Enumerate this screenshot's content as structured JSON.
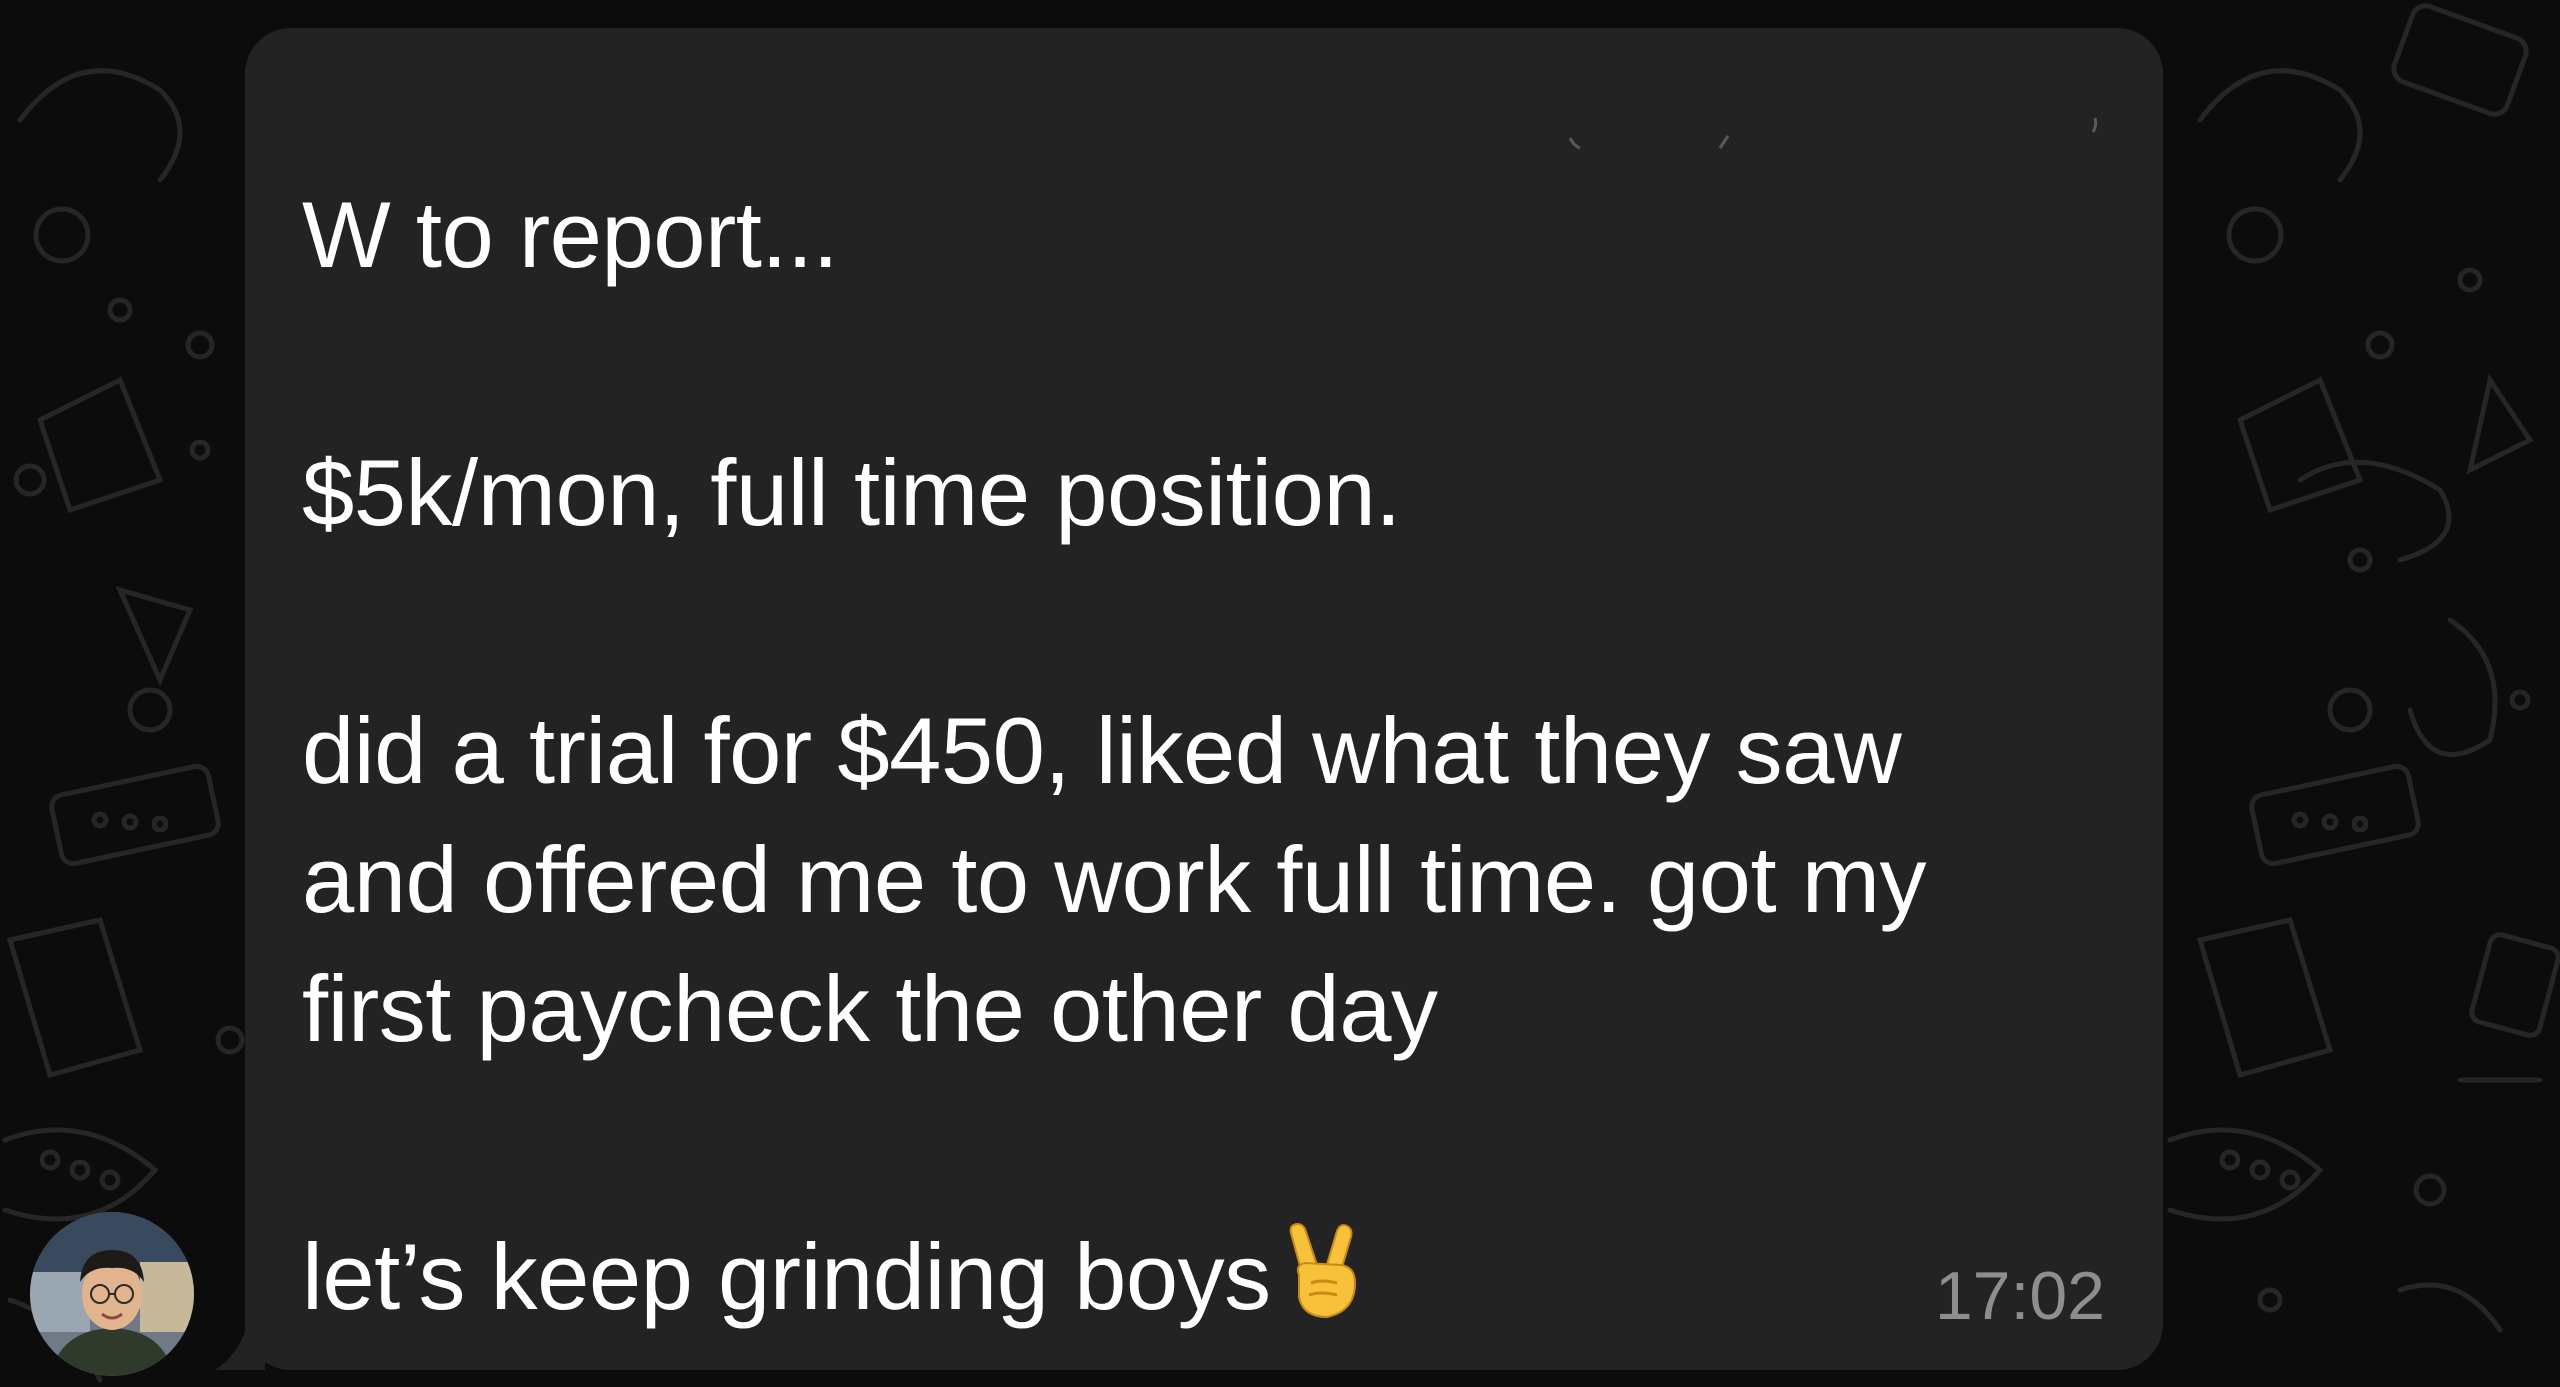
{
  "message": {
    "lines": [
      "W to report...",
      "$5k/mon, full time position.",
      "did a trial for $450, liked what they saw",
      "and offered me to work full time. got my",
      "first paycheck the other day",
      "let’s keep grinding boys"
    ],
    "emoji": "victory-hand-emoji",
    "timestamp": "17:02"
  },
  "sender": {
    "avatar_icon": "avatar-photo"
  },
  "colors": {
    "background": "#0c0c0c",
    "bubble": "#232323",
    "text": "#ffffff",
    "timestamp": "#8e8e8e",
    "doodle": "#2a2a2a"
  }
}
